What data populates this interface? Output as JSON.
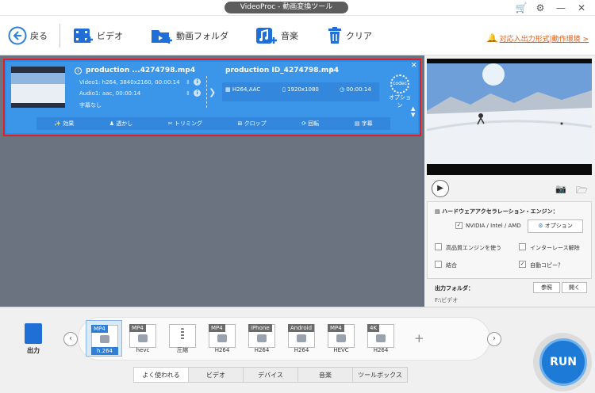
{
  "window": {
    "title": "VideoProc - 動画変換ツール"
  },
  "toolbar": {
    "back": "戻る",
    "video": "ビデオ",
    "video_folder": "動画フォルダ",
    "music": "音楽",
    "clear": "クリア",
    "notice": "対応入出力形式|動作環境 >"
  },
  "task": {
    "source_name": "production ...4274798.mp4",
    "video_info": "Video1: h264, 3840x2160, 00:00:14",
    "audio_info": "Audio1: aac, 00:00:14",
    "subtitle": "字幕なし",
    "output_name": "production ID_4274798.mp4",
    "output_codec": "H264,AAC",
    "output_res": "1920x1080",
    "output_dur": "00:00:14",
    "codec_label": "codec",
    "option_label": "オプション",
    "edit": [
      "効果",
      "透かし",
      "トリミング",
      "クロップ",
      "回転",
      "字幕"
    ]
  },
  "hardware": {
    "title": "ハードウェアアクセラレーション・エンジン：",
    "nvidia": "NVIDIA / Intel / AMD",
    "option_button": "オプション",
    "hq_engine": "高品質エンジンを使う",
    "deinterlace": "インターレース解除",
    "merge": "結合",
    "auto_copy": "自動コピー？",
    "nvidia_checked": true,
    "auto_copy_checked": true
  },
  "output_folder": {
    "label": "出力フォルダ：",
    "path": "F:\\ビデオ",
    "browse": "参照",
    "open": "開く"
  },
  "formats": [
    {
      "top": "MP4",
      "sub": "h.264",
      "selected": true
    },
    {
      "top": "MP4",
      "sub": "hevc",
      "selected": false
    },
    {
      "top": "",
      "sub": "圧縮",
      "selected": false
    },
    {
      "top": "MP4",
      "sub": "H264",
      "selected": false
    },
    {
      "top": "iPhone",
      "sub": "H264",
      "selected": false
    },
    {
      "top": "Android",
      "sub": "H264",
      "selected": false
    },
    {
      "top": "MP4",
      "sub": "HEVC",
      "selected": false
    },
    {
      "top": "4K",
      "sub": "H264",
      "selected": false
    }
  ],
  "bottom": {
    "output_label": "出力",
    "run": "RUN"
  },
  "tabs": [
    "よく使われる",
    "ビデオ",
    "デバイス",
    "音楽",
    "ツールボックス"
  ],
  "colors": {
    "accent": "#1d7ad6",
    "task_bg": "#3b95e8",
    "highlight": "#e02020",
    "notice": "#e35b14"
  }
}
